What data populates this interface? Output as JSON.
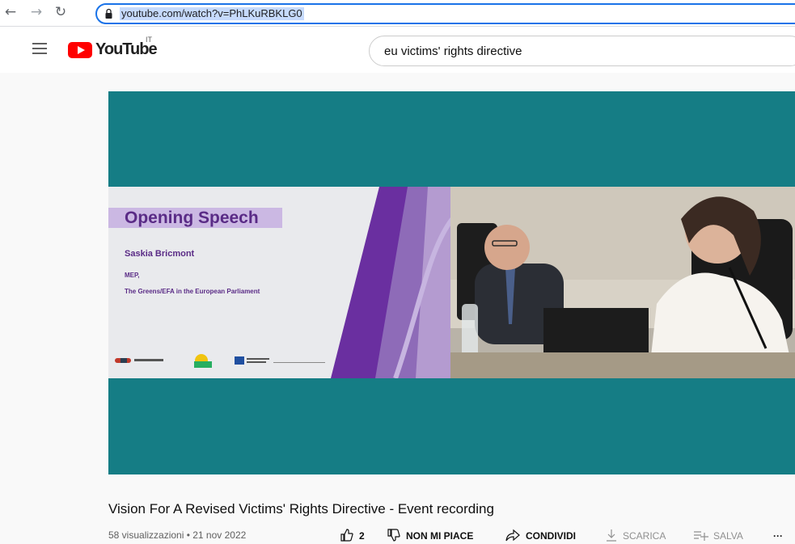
{
  "browser": {
    "url": "youtube.com/watch?v=PhLKuRBKLG0"
  },
  "header": {
    "logo_text": "YouTube",
    "country_code": "IT",
    "search_value": "eu victims' rights directive"
  },
  "slide": {
    "title": "Opening Speech",
    "speaker": "Saskia Bricmont",
    "role_line1": "MEP,",
    "role_line2": "The Greens/EFA in the European Parliament",
    "logo1_text": "Victim Support Europe"
  },
  "video": {
    "title": "Vision For A Revised Victims' Rights Directive - Event recording",
    "meta": "58 visualizzazioni • 21 nov 2022",
    "likes": "2",
    "dislike_label": "NON MI PIACE",
    "share_label": "CONDIVIDI",
    "download_label": "SCARICA",
    "save_label": "SALVA",
    "more_label": "···"
  },
  "colors": {
    "player_bg": "#157d85",
    "accent_purple": "#5a2b86",
    "youtube_red": "#ff0000"
  }
}
